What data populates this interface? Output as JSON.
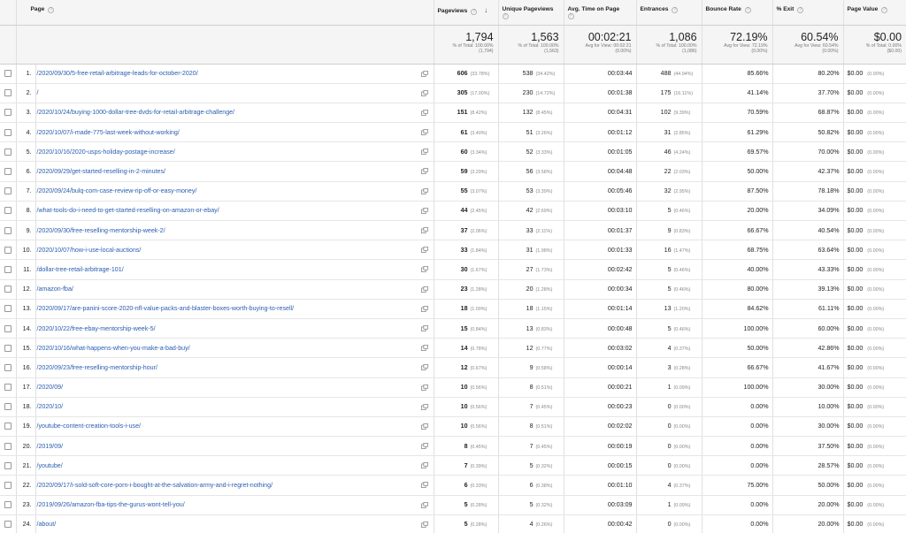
{
  "columns": {
    "page": "Page",
    "pageviews": "Pageviews",
    "unique": "Unique Pageviews",
    "avg_time": "Avg. Time on Page",
    "entrances": "Entrances",
    "bounce": "Bounce Rate",
    "exit": "% Exit",
    "value": "Page Value"
  },
  "help_glyph": "?",
  "sort_glyph": "↓",
  "icons": {
    "sort": "sort-descending-arrow-icon",
    "help": "help-question-icon",
    "open_page": "open-in-new-window-icon"
  },
  "totals": {
    "pageviews": {
      "value": "1,794",
      "sub": [
        "% of Total: 100.00%",
        "(1,794)"
      ]
    },
    "unique": {
      "value": "1,563",
      "sub": [
        "% of Total: 100.00%",
        "(1,563)"
      ]
    },
    "avg_time": {
      "value": "00:02:21",
      "sub": [
        "Avg for View: 00:02:21",
        "(0.00%)"
      ]
    },
    "entrances": {
      "value": "1,086",
      "sub": [
        "% of Total: 100.00%",
        "(1,086)"
      ]
    },
    "bounce": {
      "value": "72.19%",
      "sub": [
        "Avg for View: 72.19%",
        "(0.00%)"
      ]
    },
    "exit": {
      "value": "60.54%",
      "sub": [
        "Avg for View: 60.54%",
        "(0.00%)"
      ]
    },
    "value": {
      "value": "$0.00",
      "sub": [
        "% of Total: 0.00%",
        "($0.00)"
      ]
    }
  },
  "rows": [
    {
      "idx": "1.",
      "page": "/2020/09/30/5-free-retail-arbitrage-leads-for-october-2020/",
      "pv": "606",
      "pvp": "(33.78%)",
      "up": "538",
      "upp": "(34.42%)",
      "time": "00:03:44",
      "ent": "488",
      "entp": "(44.94%)",
      "bounce": "85.66%",
      "exit": "80.20%",
      "val": "$0.00",
      "valp": "(0.00%)"
    },
    {
      "idx": "2.",
      "page": "/",
      "pv": "305",
      "pvp": "(17.00%)",
      "up": "230",
      "upp": "(14.72%)",
      "time": "00:01:38",
      "ent": "175",
      "entp": "(16.11%)",
      "bounce": "41.14%",
      "exit": "37.70%",
      "val": "$0.00",
      "valp": "(0.00%)"
    },
    {
      "idx": "3.",
      "page": "/2020/10/24/buying-1000-dollar-tree-dvds-for-retail-arbitrage-challenge/",
      "pv": "151",
      "pvp": "(8.42%)",
      "up": "132",
      "upp": "(8.45%)",
      "time": "00:04:31",
      "ent": "102",
      "entp": "(9.39%)",
      "bounce": "70.59%",
      "exit": "68.87%",
      "val": "$0.00",
      "valp": "(0.00%)"
    },
    {
      "idx": "4.",
      "page": "/2020/10/07/i-made-775-last-week-without-working/",
      "pv": "61",
      "pvp": "(3.40%)",
      "up": "51",
      "upp": "(3.26%)",
      "time": "00:01:12",
      "ent": "31",
      "entp": "(2.85%)",
      "bounce": "61.29%",
      "exit": "50.82%",
      "val": "$0.00",
      "valp": "(0.00%)"
    },
    {
      "idx": "5.",
      "page": "/2020/10/16/2020-usps-holiday-postage-increase/",
      "pv": "60",
      "pvp": "(3.34%)",
      "up": "52",
      "upp": "(3.33%)",
      "time": "00:01:05",
      "ent": "46",
      "entp": "(4.24%)",
      "bounce": "69.57%",
      "exit": "70.00%",
      "val": "$0.00",
      "valp": "(0.00%)"
    },
    {
      "idx": "6.",
      "page": "/2020/09/29/get-started-reselling-in-2-minutes/",
      "pv": "59",
      "pvp": "(3.29%)",
      "up": "56",
      "upp": "(3.58%)",
      "time": "00:04:48",
      "ent": "22",
      "entp": "(2.03%)",
      "bounce": "50.00%",
      "exit": "42.37%",
      "val": "$0.00",
      "valp": "(0.00%)"
    },
    {
      "idx": "7.",
      "page": "/2020/09/24/bulq-com-case-review-rip-off-or-easy-money/",
      "pv": "55",
      "pvp": "(3.07%)",
      "up": "53",
      "upp": "(3.39%)",
      "time": "00:05:46",
      "ent": "32",
      "entp": "(2.95%)",
      "bounce": "87.50%",
      "exit": "78.18%",
      "val": "$0.00",
      "valp": "(0.00%)"
    },
    {
      "idx": "8.",
      "page": "/what-tools-do-i-need-to-get-started-reselling-on-amazon-or-ebay/",
      "pv": "44",
      "pvp": "(2.45%)",
      "up": "42",
      "upp": "(2.69%)",
      "time": "00:03:10",
      "ent": "5",
      "entp": "(0.46%)",
      "bounce": "20.00%",
      "exit": "34.09%",
      "val": "$0.00",
      "valp": "(0.00%)"
    },
    {
      "idx": "9.",
      "page": "/2020/09/30/free-reselling-mentorship-week-2/",
      "pv": "37",
      "pvp": "(2.06%)",
      "up": "33",
      "upp": "(2.11%)",
      "time": "00:01:37",
      "ent": "9",
      "entp": "(0.83%)",
      "bounce": "66.67%",
      "exit": "40.54%",
      "val": "$0.00",
      "valp": "(0.00%)"
    },
    {
      "idx": "10.",
      "page": "/2020/10/07/how-i-use-local-auctions/",
      "pv": "33",
      "pvp": "(1.84%)",
      "up": "31",
      "upp": "(1.98%)",
      "time": "00:01:33",
      "ent": "16",
      "entp": "(1.47%)",
      "bounce": "68.75%",
      "exit": "63.64%",
      "val": "$0.00",
      "valp": "(0.00%)"
    },
    {
      "idx": "11.",
      "page": "/dollar-tree-retail-arbitrage-101/",
      "pv": "30",
      "pvp": "(1.67%)",
      "up": "27",
      "upp": "(1.73%)",
      "time": "00:02:42",
      "ent": "5",
      "entp": "(0.46%)",
      "bounce": "40.00%",
      "exit": "43.33%",
      "val": "$0.00",
      "valp": "(0.00%)"
    },
    {
      "idx": "12.",
      "page": "/amazon-fba/",
      "pv": "23",
      "pvp": "(1.28%)",
      "up": "20",
      "upp": "(1.28%)",
      "time": "00:00:34",
      "ent": "5",
      "entp": "(0.46%)",
      "bounce": "80.00%",
      "exit": "39.13%",
      "val": "$0.00",
      "valp": "(0.00%)"
    },
    {
      "idx": "13.",
      "page": "/2020/09/17/are-panini-score-2020-nfl-value-packs-and-blaster-boxes-worth-buying-to-resell/",
      "pv": "18",
      "pvp": "(1.00%)",
      "up": "18",
      "upp": "(1.15%)",
      "time": "00:01:14",
      "ent": "13",
      "entp": "(1.20%)",
      "bounce": "84.62%",
      "exit": "61.11%",
      "val": "$0.00",
      "valp": "(0.00%)"
    },
    {
      "idx": "14.",
      "page": "/2020/10/22/free-ebay-mentorship-week-5/",
      "pv": "15",
      "pvp": "(0.84%)",
      "up": "13",
      "upp": "(0.83%)",
      "time": "00:00:48",
      "ent": "5",
      "entp": "(0.46%)",
      "bounce": "100.00%",
      "exit": "60.00%",
      "val": "$0.00",
      "valp": "(0.00%)"
    },
    {
      "idx": "15.",
      "page": "/2020/10/16/what-happens-when-you-make-a-bad-buy/",
      "pv": "14",
      "pvp": "(0.78%)",
      "up": "12",
      "upp": "(0.77%)",
      "time": "00:03:02",
      "ent": "4",
      "entp": "(0.37%)",
      "bounce": "50.00%",
      "exit": "42.86%",
      "val": "$0.00",
      "valp": "(0.00%)"
    },
    {
      "idx": "16.",
      "page": "/2020/09/23/free-reselling-mentorship-hour/",
      "pv": "12",
      "pvp": "(0.67%)",
      "up": "9",
      "upp": "(0.58%)",
      "time": "00:00:14",
      "ent": "3",
      "entp": "(0.28%)",
      "bounce": "66.67%",
      "exit": "41.67%",
      "val": "$0.00",
      "valp": "(0.00%)"
    },
    {
      "idx": "17.",
      "page": "/2020/09/",
      "pv": "10",
      "pvp": "(0.56%)",
      "up": "8",
      "upp": "(0.51%)",
      "time": "00:00:21",
      "ent": "1",
      "entp": "(0.09%)",
      "bounce": "100.00%",
      "exit": "30.00%",
      "val": "$0.00",
      "valp": "(0.00%)"
    },
    {
      "idx": "18.",
      "page": "/2020/10/",
      "pv": "10",
      "pvp": "(0.56%)",
      "up": "7",
      "upp": "(0.45%)",
      "time": "00:00:23",
      "ent": "0",
      "entp": "(0.00%)",
      "bounce": "0.00%",
      "exit": "10.00%",
      "val": "$0.00",
      "valp": "(0.00%)"
    },
    {
      "idx": "19.",
      "page": "/youtube-content-creation-tools-i-use/",
      "pv": "10",
      "pvp": "(0.56%)",
      "up": "8",
      "upp": "(0.51%)",
      "time": "00:02:02",
      "ent": "0",
      "entp": "(0.00%)",
      "bounce": "0.00%",
      "exit": "30.00%",
      "val": "$0.00",
      "valp": "(0.00%)"
    },
    {
      "idx": "20.",
      "page": "/2019/09/",
      "pv": "8",
      "pvp": "(0.45%)",
      "up": "7",
      "upp": "(0.45%)",
      "time": "00:00:19",
      "ent": "0",
      "entp": "(0.00%)",
      "bounce": "0.00%",
      "exit": "37.50%",
      "val": "$0.00",
      "valp": "(0.00%)"
    },
    {
      "idx": "21.",
      "page": "/youtube/",
      "pv": "7",
      "pvp": "(0.39%)",
      "up": "5",
      "upp": "(0.32%)",
      "time": "00:00:15",
      "ent": "0",
      "entp": "(0.00%)",
      "bounce": "0.00%",
      "exit": "28.57%",
      "val": "$0.00",
      "valp": "(0.00%)"
    },
    {
      "idx": "22.",
      "page": "/2020/09/17/i-sold-soft-core-porn-i-bought-at-the-salvation-army-and-i-regret-nothing/",
      "pv": "6",
      "pvp": "(0.33%)",
      "up": "6",
      "upp": "(0.38%)",
      "time": "00:01:10",
      "ent": "4",
      "entp": "(0.37%)",
      "bounce": "75.00%",
      "exit": "50.00%",
      "val": "$0.00",
      "valp": "(0.00%)"
    },
    {
      "idx": "23.",
      "page": "/2019/09/26/amazon-fba-tips-the-gurus-wont-tell-you/",
      "pv": "5",
      "pvp": "(0.28%)",
      "up": "5",
      "upp": "(0.32%)",
      "time": "00:03:09",
      "ent": "1",
      "entp": "(0.09%)",
      "bounce": "0.00%",
      "exit": "20.00%",
      "val": "$0.00",
      "valp": "(0.00%)"
    },
    {
      "idx": "24.",
      "page": "/about/",
      "pv": "5",
      "pvp": "(0.28%)",
      "up": "4",
      "upp": "(0.26%)",
      "time": "00:00:42",
      "ent": "0",
      "entp": "(0.00%)",
      "bounce": "0.00%",
      "exit": "20.00%",
      "val": "$0.00",
      "valp": "(0.00%)"
    }
  ]
}
